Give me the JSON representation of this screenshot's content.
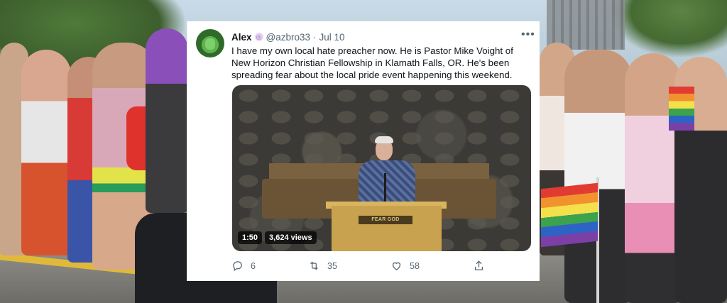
{
  "tweet": {
    "author_name": "Alex",
    "handle": "@azbro33",
    "separator": "·",
    "date": "Jul 10",
    "more_label": "•••",
    "text": "I have my own local hate preacher now. He is Pastor Mike Voight of New Horizon Christian Fellowship in Klamath Falls, OR. He's been spreading fear about the local pride event happening this weekend.",
    "media": {
      "duration": "1:50",
      "views": "3,624 views",
      "pulpit_sign": "FEAR GOD"
    },
    "actions": {
      "reply": {
        "icon": "reply-icon",
        "count": "6"
      },
      "retweet": {
        "icon": "retweet-icon",
        "count": "35"
      },
      "like": {
        "icon": "heart-icon",
        "count": "58"
      },
      "share": {
        "icon": "share-icon",
        "count": ""
      }
    }
  },
  "colors": {
    "card_background": "#ffffff",
    "text_primary": "#0f1419",
    "text_secondary": "#536471"
  }
}
